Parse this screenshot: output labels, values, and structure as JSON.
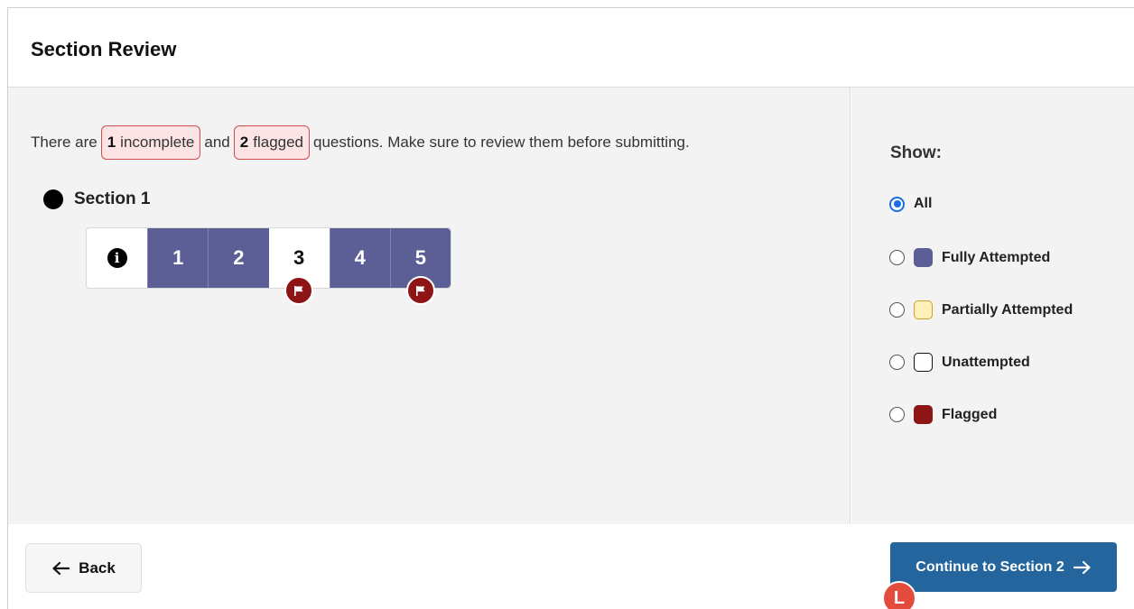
{
  "header": {
    "title": "Section Review"
  },
  "summary": {
    "prefix": "There are",
    "incomplete_count": "1",
    "incomplete_label": "incomplete",
    "and": "and",
    "flagged_count": "2",
    "flagged_label": "flagged",
    "suffix": "questions. Make sure to review them before submitting."
  },
  "section": {
    "title": "Section 1"
  },
  "questions": [
    {
      "label": "1",
      "status": "fully-attempted",
      "flagged": false
    },
    {
      "label": "2",
      "status": "fully-attempted",
      "flagged": false
    },
    {
      "label": "3",
      "status": "unattempted",
      "flagged": true
    },
    {
      "label": "4",
      "status": "fully-attempted",
      "flagged": false
    },
    {
      "label": "5",
      "status": "fully-attempted",
      "flagged": true
    }
  ],
  "filter": {
    "title": "Show:",
    "selected": "All",
    "options": [
      {
        "label": "All"
      },
      {
        "label": "Fully Attempted",
        "color": "#5c5f96"
      },
      {
        "label": "Partially Attempted",
        "color": "#fdf0b8"
      },
      {
        "label": "Unattempted",
        "color": "#ffffff"
      },
      {
        "label": "Flagged",
        "color": "#8e1515"
      }
    ]
  },
  "footer": {
    "back_label": "Back",
    "continue_label": "Continue to Section 2",
    "cursor_badge": "L"
  },
  "colors": {
    "fully_attempted": "#5c5f96",
    "flagged": "#8e1515",
    "primary_button": "#23659c",
    "radio_selected": "#1a6ee0"
  }
}
